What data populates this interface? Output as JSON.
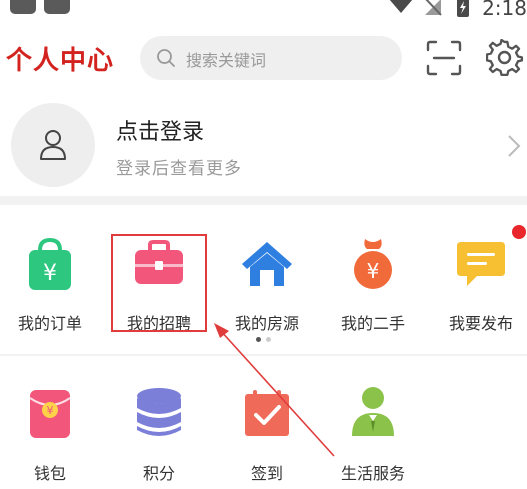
{
  "status_bar": {
    "time": "2:18"
  },
  "header": {
    "title": "个人中心",
    "search_placeholder": "搜索关键词"
  },
  "login": {
    "title": "点击登录",
    "subtitle": "登录后查看更多"
  },
  "menu_row_1": [
    {
      "label": "我的订单",
      "icon": "shopping-bag-icon",
      "color": "#2ec780"
    },
    {
      "label": "我的招聘",
      "icon": "briefcase-icon",
      "color": "#f2567a"
    },
    {
      "label": "我的房源",
      "icon": "house-icon",
      "color": "#2f7fe0"
    },
    {
      "label": "我的二手",
      "icon": "money-bag-icon",
      "color": "#f06a3a"
    },
    {
      "label": "我要发布",
      "icon": "message-icon",
      "color": "#f7c033"
    }
  ],
  "menu_row_2": [
    {
      "label": "钱包",
      "icon": "red-envelope-icon",
      "color": "#f2567a"
    },
    {
      "label": "积分",
      "icon": "coin-stack-icon",
      "color": "#7b7fd8"
    },
    {
      "label": "签到",
      "icon": "checkin-icon",
      "color": "#f06a5a"
    },
    {
      "label": "生活服务",
      "icon": "service-person-icon",
      "color": "#8bc34a"
    }
  ],
  "colors": {
    "accent": "#d2231f",
    "highlight": "#e03c3c"
  }
}
